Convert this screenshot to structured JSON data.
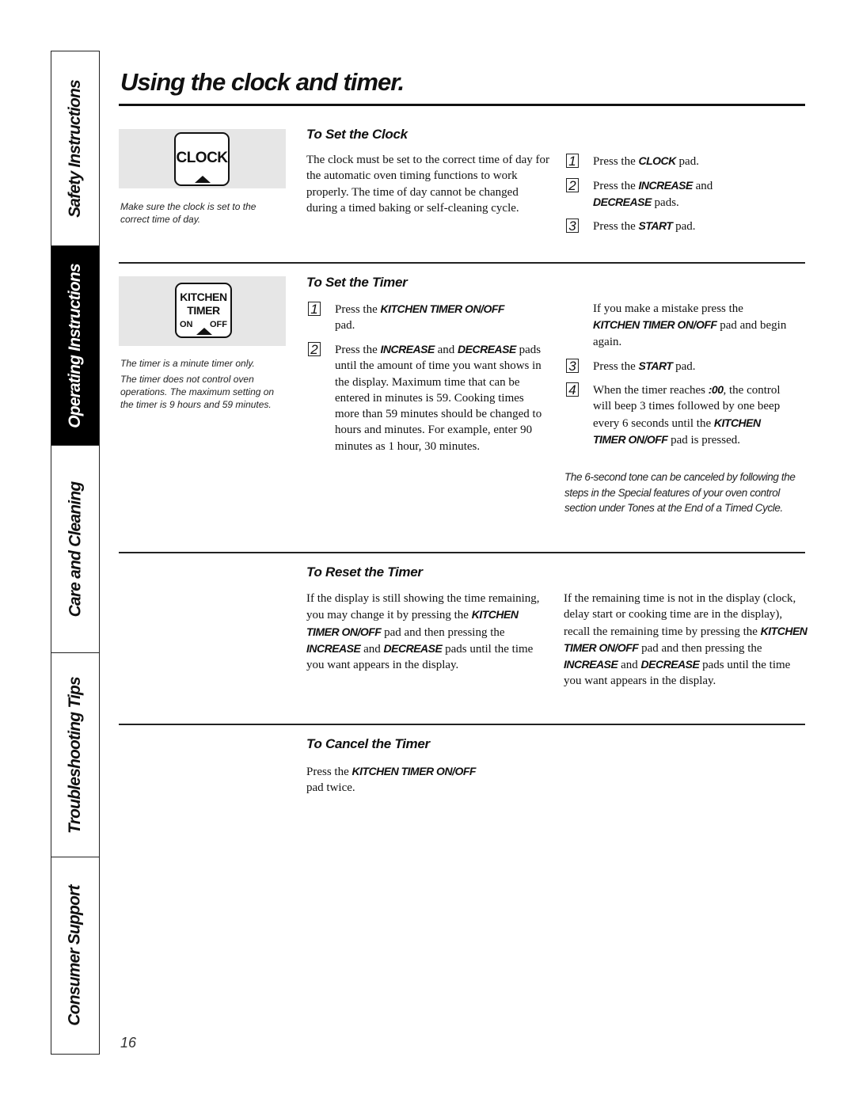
{
  "sidebar": {
    "tabs": [
      {
        "label": "Safety Instructions",
        "active": false
      },
      {
        "label": "Operating Instructions",
        "active": true
      },
      {
        "label": "Care and Cleaning",
        "active": false
      },
      {
        "label": "Troubleshooting Tips",
        "active": false
      },
      {
        "label": "Consumer Support",
        "active": false
      }
    ]
  },
  "page": {
    "title": "Using the clock and timer.",
    "page_number": "16"
  },
  "clock_section": {
    "pad_label": "CLOCK",
    "caption": "Make sure the clock is set to the correct time of day.",
    "heading": "To Set the Clock",
    "intro": "The clock must be set to the correct time of day for the automatic oven timing functions to work properly. The time of day cannot be changed during a timed baking or self-cleaning cycle.",
    "steps": [
      {
        "num": "1",
        "pre": "Press the ",
        "kw1": "CLOCK",
        "mid": " pad.",
        "kw2": "",
        "post": ""
      },
      {
        "num": "2",
        "pre": "Press the ",
        "kw1": "INCREASE",
        "mid": " and ",
        "kw2": "DECREASE",
        "post": " pads."
      },
      {
        "num": "3",
        "pre": "Press the ",
        "kw1": "START",
        "mid": " pad.",
        "kw2": "",
        "post": ""
      }
    ]
  },
  "timer_section": {
    "pad_line1": "KITCHEN",
    "pad_line2": "TIMER",
    "pad_on": "ON",
    "pad_off": "OFF",
    "caption1": "The timer is a minute timer only.",
    "caption2": "The timer does not control oven operations. The maximum setting on the timer is 9 hours and 59 minutes.",
    "heading": "To Set the Timer",
    "step1": {
      "num": "1",
      "pre": "Press the ",
      "kw": "KITCHEN TIMER ON/OFF",
      "post": " pad."
    },
    "step2": {
      "num": "2",
      "pre": "Press the ",
      "kw1": "INCREASE",
      "mid": " and ",
      "kw2": "DECREASE",
      "post": " pads until the amount of time you want shows in the display. Maximum time that can be entered in minutes is 59. Cooking times more than 59 minutes should be changed to hours and minutes. For example, enter 90 minutes as 1 hour, 30 minutes."
    },
    "mistake": {
      "pre": "If you make a mistake press the ",
      "kw": "KITCHEN TIMER ON/OFF",
      "post": " pad and begin again."
    },
    "step3": {
      "num": "3",
      "pre": "Press the ",
      "kw": "START",
      "post": " pad."
    },
    "step4": {
      "num": "4",
      "pre": "When the timer reaches ",
      "kw1": ":00",
      "mid": ", the control will beep 3 times followed by one beep every 6 seconds until the ",
      "kw2": "KITCHEN TIMER ON/OFF",
      "post": " pad is pressed."
    },
    "note": "The 6-second tone can be canceled by following the steps in the Special features of your oven control section under Tones at the End of a Timed Cycle."
  },
  "reset_section": {
    "heading": "To Reset the Timer",
    "left": {
      "p1": "If the display is still showing the time remaining, you may change it by pressing the ",
      "kw1": "KITCHEN TIMER ON/OFF",
      "p2": " pad and then pressing the ",
      "kw2": "INCREASE",
      "p3": " and ",
      "kw3": "DECREASE",
      "p4": " pads until the time you want appears in the display."
    },
    "right": {
      "p1": "If the remaining time is not in the display (clock, delay start or cooking time are in the display), recall the remaining time by pressing the ",
      "kw1": "KITCHEN TIMER ON/OFF",
      "p2": " pad and then pressing the ",
      "kw2": "INCREASE",
      "p3": " and ",
      "kw3": "DECREASE",
      "p4": " pads until the time you want appears in the display."
    }
  },
  "cancel_section": {
    "heading": "To Cancel the Timer",
    "pre": "Press the ",
    "kw": "KITCHEN TIMER ON/OFF",
    "post": " pad twice."
  }
}
